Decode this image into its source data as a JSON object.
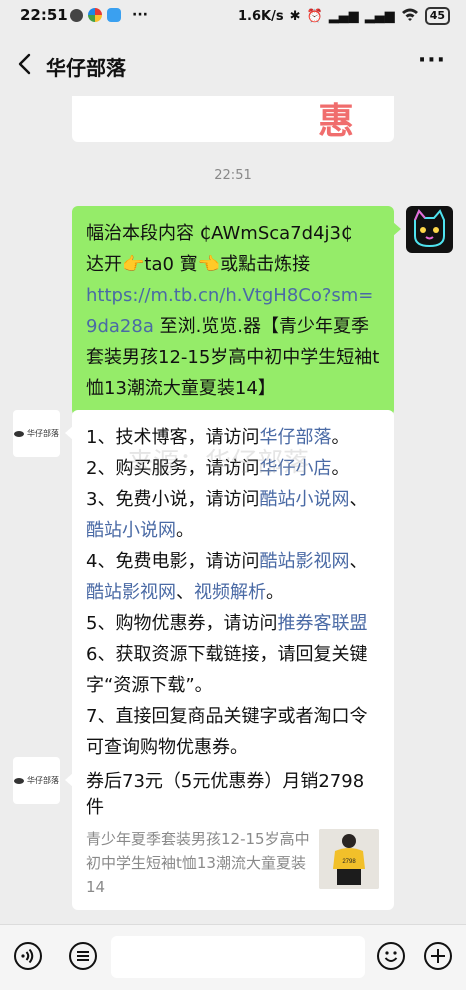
{
  "status_bar": {
    "time": "22:51",
    "more": "···",
    "network_speed": "1.6K/s",
    "battery": "45"
  },
  "header": {
    "title": "华仔部落",
    "more": "···"
  },
  "chat": {
    "prev_card_text": "惠",
    "timestamp": "22:51",
    "sent_message": {
      "line1": "幅治本段内容 ₵AWmSca7d4j3₵",
      "line2": "达开👉ta0 寶👈或點击炼接",
      "link": "https://m.tb.cn/h.VtgH8Co?sm=9da28a",
      "line3": " 至浏.览览.器【青少年夏季套装男孩12-15岁高中初中学生短袖t恤13潮流大童夏装14】"
    },
    "reply": {
      "avatar_label": "华仔部落",
      "watermark": "来源：华仔部落",
      "items": [
        {
          "prefix": "1、技术博客，请访问",
          "link": "华仔部落",
          "suffix": "。"
        },
        {
          "prefix": "2、购买服务，请访问",
          "link": "华仔小店",
          "suffix": "。"
        },
        {
          "prefix": "3、免费小说，请访问",
          "link": "酷站小说网",
          "suffix": "、"
        },
        {
          "prefix": "",
          "link": "酷站小说网",
          "suffix": "。"
        },
        {
          "prefix": "4、免费电影，请访问",
          "link": "酷站影视网",
          "suffix": "、"
        },
        {
          "prefix": "",
          "link": "酷站影视网",
          "suffix": "、"
        },
        {
          "prefix": "",
          "link": "视频解析",
          "suffix": "。"
        },
        {
          "prefix": "5、购物优惠券，请访问",
          "link": "推券客联盟",
          "suffix": ""
        },
        {
          "prefix": "6、获取资源下载链接，请回复关键字“资源下载”。",
          "link": "",
          "suffix": ""
        },
        {
          "prefix": "7、直接回复商品关键字或者淘口令可查询购物优惠券。",
          "link": "",
          "suffix": ""
        }
      ]
    },
    "product_card": {
      "avatar_label": "华仔部落",
      "title": "券后73元（5元优惠券）月销2798件",
      "description": "青少年夏季套装男孩12-15岁高中初中学生短袖t恤13潮流大童夏装14"
    }
  },
  "input_bar": {
    "voice_icon": "voice-icon",
    "emoji_icon": "emoji-icon",
    "plus_icon": "plus-icon"
  },
  "colors": {
    "background": "#ededed",
    "sent_bubble": "#95ec69",
    "link": "#4a6aa5"
  }
}
